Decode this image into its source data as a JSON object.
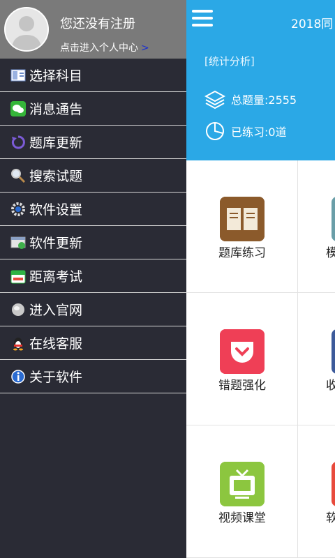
{
  "profile": {
    "name": "您还没有注册",
    "subtitle": "点击进入个人中心",
    "arrow": ">"
  },
  "menu": {
    "items": [
      {
        "label": "选择科目",
        "icon": "book-select-icon"
      },
      {
        "label": "消息通告",
        "icon": "wechat-message-icon"
      },
      {
        "label": "题库更新",
        "icon": "refresh-icon"
      },
      {
        "label": "搜索试题",
        "icon": "search-icon"
      },
      {
        "label": "软件设置",
        "icon": "gear-icon"
      },
      {
        "label": "软件更新",
        "icon": "update-icon"
      },
      {
        "label": "距离考试",
        "icon": "calendar-icon"
      },
      {
        "label": "进入官网",
        "icon": "globe-icon"
      },
      {
        "label": "在线客服",
        "icon": "qq-penguin-icon"
      },
      {
        "label": "关于软件",
        "icon": "info-icon"
      }
    ]
  },
  "header": {
    "title": "2018同",
    "stats_link": "[统计分析]",
    "total_questions": "总题量:2555",
    "practiced": "已练习:0道"
  },
  "grid": {
    "tiles": [
      {
        "label": "题库练习",
        "icon": "open-book-icon",
        "color": "#8b5a2b"
      },
      {
        "label": "模",
        "icon": "partial-tile-icon",
        "color": "#6a9ea8"
      },
      {
        "label": "错题强化",
        "icon": "pocket-icon",
        "color": "#ef3f56"
      },
      {
        "label": "收",
        "icon": "partial-tile-icon",
        "color": "#3c5a9a"
      },
      {
        "label": "视频课堂",
        "icon": "tv-icon",
        "color": "#8cc63f"
      },
      {
        "label": "软",
        "icon": "partial-tile-icon",
        "color": "#e84a3c"
      }
    ]
  },
  "colors": {
    "accent": "#2ba8e6",
    "drawer_bg": "#2a2b35",
    "profile_bg": "#7a7a7a"
  }
}
